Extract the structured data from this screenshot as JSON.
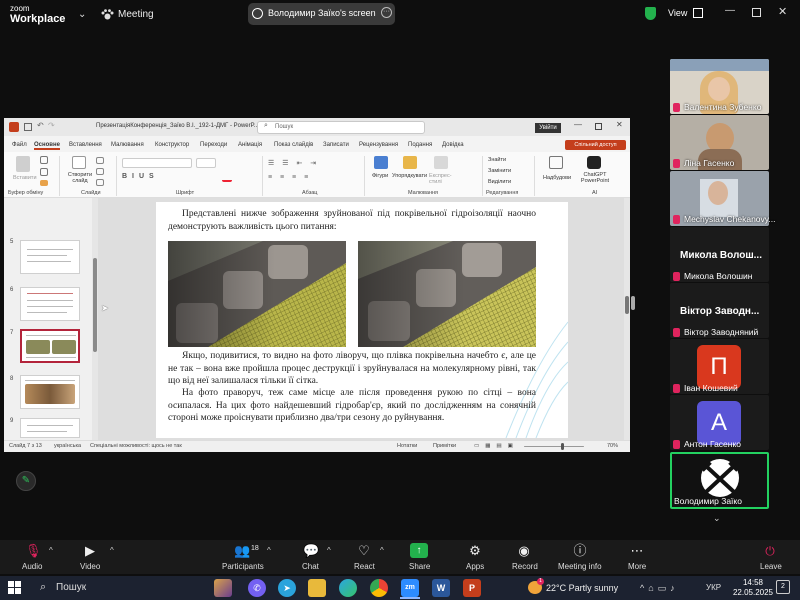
{
  "zoom": {
    "logo_top": "zoom",
    "logo_bottom": "Workplace",
    "meeting_label": "Meeting",
    "share_banner": "Володимир Заїко's screen",
    "view_label": "View",
    "more_glyph": "···",
    "participant_count": "18",
    "toolbar": {
      "audio": "Audio",
      "video": "Video",
      "participants": "Participants",
      "chat": "Chat",
      "react": "React",
      "share": "Share",
      "apps": "Apps",
      "record": "Record",
      "meeting_info": "Meeting info",
      "more": "More",
      "leave": "Leave"
    },
    "participants": [
      {
        "name": "Валентина Зубенко",
        "muted": true
      },
      {
        "name": "Ліна Гасенко",
        "muted": true
      },
      {
        "name": "Mechyslav Chekanovy...",
        "muted": true
      },
      {
        "name": "Микола Волош...",
        "caption": "Микола Волошин",
        "muted": true
      },
      {
        "name": "Віктор Заводн...",
        "caption": "Віктор Заводняний",
        "muted": true
      },
      {
        "name": "Іван Кошевий",
        "initial": "П",
        "color": "#d9381e",
        "muted": true
      },
      {
        "name": "Антон Гасенко",
        "initial": "A",
        "color": "#5a55d6",
        "muted": true
      },
      {
        "name": "Володимир Заїко",
        "muted": false
      }
    ]
  },
  "powerpoint": {
    "filename": "ПрезентаціяКонференція_Заїко В.І._192-1-ДМГ  -  PowerP...",
    "search_placeholder": "Пошук",
    "sign_in": "Увійти",
    "share_button": "Спільний доступ",
    "tabs": [
      "Файл",
      "Основне",
      "Вставлення",
      "Малювання",
      "Конструктор",
      "Переходи",
      "Анімація",
      "Показ слайдів",
      "Записати",
      "Рецензування",
      "Подання",
      "Довідка"
    ],
    "ribbon": {
      "paste": "Вставити",
      "new_slide": "Створити слайд",
      "clipboard": "Буфер обміну",
      "slides": "Слайди",
      "font": "Шрифт",
      "paragraph": "Абзац",
      "shapes": "Фігури",
      "arrange": "Упорядкувати",
      "quick_styles": "Експрес-стилі",
      "drawing": "Малювання",
      "find": "Знайти",
      "replace": "Замінити",
      "select": "Виділити",
      "editing": "Редагування",
      "addins": "Надбудови",
      "chatgpt": "ChatGPT PowerPoint",
      "ai": "AI"
    },
    "thumb_numbers": [
      "5",
      "6",
      "7",
      "8",
      "9"
    ],
    "slide": {
      "para1": "Представлені нижче зображення зруйнованої під покрівельної гідроізоляції наочно демонструють важливість цього питання:",
      "para2": "Якщо, подивитися, то видно на фото ліворуч, що плівка покрівельна начебто є, але це не так – вона вже пройшла процес деструкції і зруйнувалася на молекулярному рівні, так що від неї залишалася тільки її сітка.",
      "para3": "На фото праворуч, теж саме місце але після проведення рукою по сітці – вона осипалася. На цих фото найдешевший гідробар'єр, який по дослідженням на сонячній стороні може проіснувати приблизно два/три сезону до руйнування."
    },
    "status": {
      "slide_of": "Слайд 7 з 13",
      "language": "українська",
      "accessibility": "Спеціальні можливості: щось не так",
      "notes": "Нотатки",
      "comments": "Примітки",
      "zoom": "70%"
    }
  },
  "taskbar": {
    "search": "Пошук",
    "weather": "22°C  Partly sunny",
    "weather_badge": "1",
    "lang": "УКР",
    "time": "14:58",
    "date": "22.05.2025",
    "notif_count": "2"
  }
}
